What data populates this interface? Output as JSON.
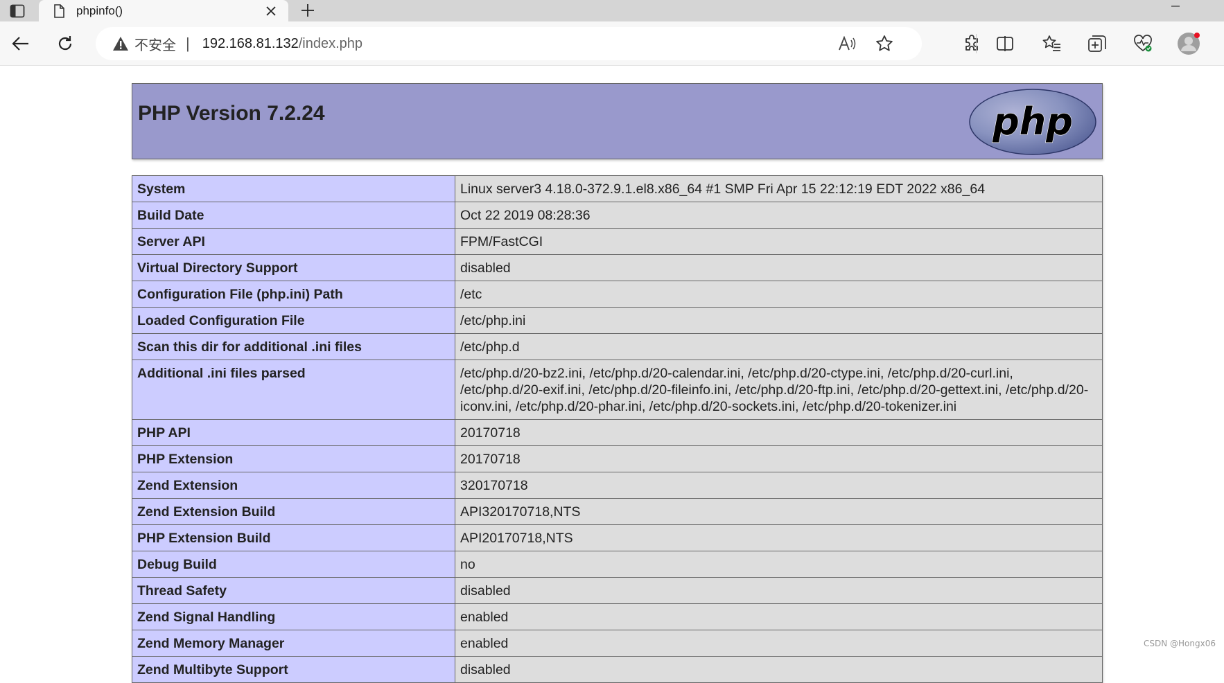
{
  "browser": {
    "tab": {
      "title": "phpinfo()",
      "favicon": "page-icon"
    },
    "address_bar": {
      "security_label": "不安全",
      "separator": "|",
      "url_host": "192.168.81.132",
      "url_path": "/index.php"
    },
    "icons": {
      "tab_actions": "tab-actions-icon",
      "close": "close-icon",
      "new_tab": "plus-icon",
      "back": "back-arrow-icon",
      "refresh": "refresh-icon",
      "warning": "warning-icon",
      "read_aloud": "read-aloud-icon",
      "favorite": "star-icon",
      "extensions": "puzzle-icon",
      "split_screen": "split-screen-icon",
      "favorites_list": "favorites-icon",
      "collections": "collections-icon",
      "browser_essentials": "heart-pulse-icon",
      "profile": "avatar-icon"
    },
    "colors": {
      "tabbar": "#d5d5d5",
      "toolbar": "#f7f7f7",
      "profile_badge": "#e81123"
    }
  },
  "phpinfo": {
    "title": "PHP Version 7.2.24",
    "logo_text": "php",
    "colors": {
      "header": "#9999cc",
      "key_cell": "#ccccff",
      "value_cell": "#dddddd",
      "logo": "#8892bf"
    },
    "rows": [
      {
        "key": "System",
        "value": "Linux server3 4.18.0-372.9.1.el8.x86_64 #1 SMP Fri Apr 15 22:12:19 EDT 2022 x86_64"
      },
      {
        "key": "Build Date",
        "value": "Oct 22 2019 08:28:36"
      },
      {
        "key": "Server API",
        "value": "FPM/FastCGI"
      },
      {
        "key": "Virtual Directory Support",
        "value": "disabled"
      },
      {
        "key": "Configuration File (php.ini) Path",
        "value": "/etc"
      },
      {
        "key": "Loaded Configuration File",
        "value": "/etc/php.ini"
      },
      {
        "key": "Scan this dir for additional .ini files",
        "value": "/etc/php.d"
      },
      {
        "key": "Additional .ini files parsed",
        "value": "/etc/php.d/20-bz2.ini, /etc/php.d/20-calendar.ini, /etc/php.d/20-ctype.ini, /etc/php.d/20-curl.ini, /etc/php.d/20-exif.ini, /etc/php.d/20-fileinfo.ini, /etc/php.d/20-ftp.ini, /etc/php.d/20-gettext.ini, /etc/php.d/20-iconv.ini, /etc/php.d/20-phar.ini, /etc/php.d/20-sockets.ini, /etc/php.d/20-tokenizer.ini"
      },
      {
        "key": "PHP API",
        "value": "20170718"
      },
      {
        "key": "PHP Extension",
        "value": "20170718"
      },
      {
        "key": "Zend Extension",
        "value": "320170718"
      },
      {
        "key": "Zend Extension Build",
        "value": "API320170718,NTS"
      },
      {
        "key": "PHP Extension Build",
        "value": "API20170718,NTS"
      },
      {
        "key": "Debug Build",
        "value": "no"
      },
      {
        "key": "Thread Safety",
        "value": "disabled"
      },
      {
        "key": "Zend Signal Handling",
        "value": "enabled"
      },
      {
        "key": "Zend Memory Manager",
        "value": "enabled"
      },
      {
        "key": "Zend Multibyte Support",
        "value": "disabled"
      }
    ]
  },
  "watermark": "CSDN @Hongx06"
}
